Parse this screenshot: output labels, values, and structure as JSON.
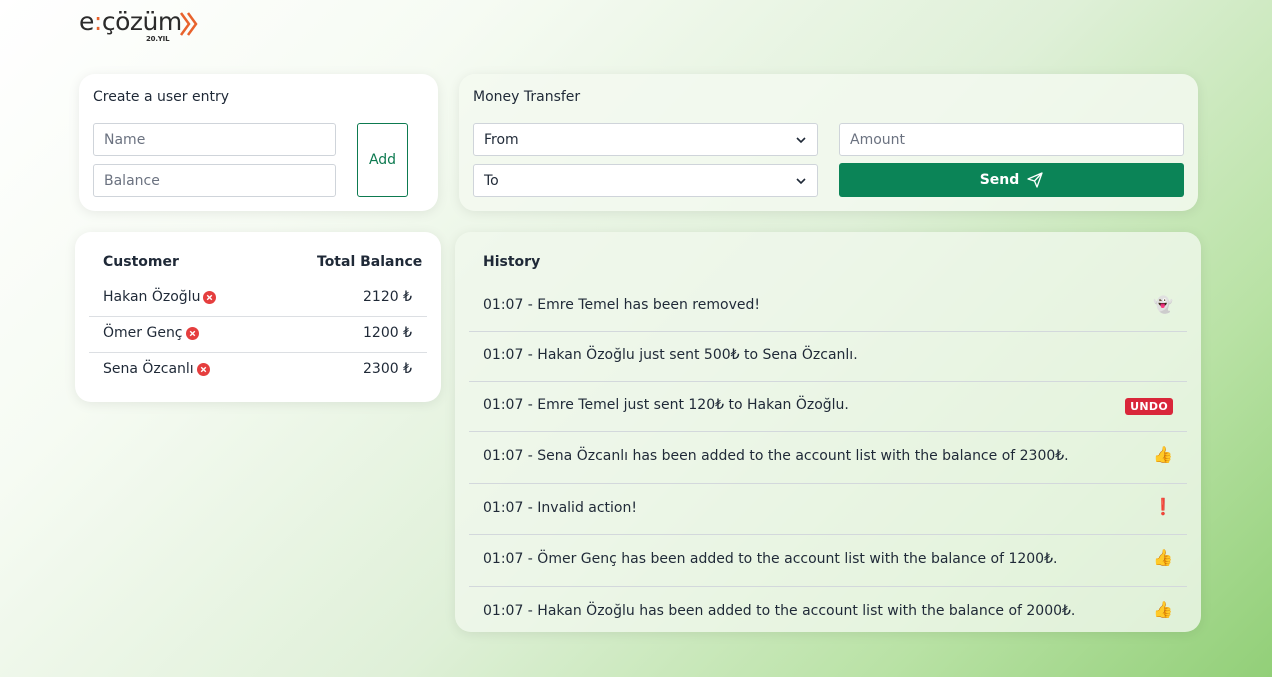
{
  "logo": {
    "brand_main": "e",
    "brand_dot": ":",
    "brand_rest": "çözüm",
    "subtitle": "20.YIL"
  },
  "create_entry": {
    "title": "Create a user entry",
    "name_placeholder": "Name",
    "balance_placeholder": "Balance",
    "add_label": "Add"
  },
  "transfer": {
    "title": "Money Transfer",
    "from_label": "From",
    "to_label": "To",
    "amount_placeholder": "Amount",
    "send_label": "Send"
  },
  "customers": {
    "header_customer": "Customer",
    "header_balance": "Total Balance",
    "rows": [
      {
        "name": "Hakan Özoğlu",
        "balance": "2120 ₺"
      },
      {
        "name": "Ömer Genç",
        "balance": "1200 ₺"
      },
      {
        "name": "Sena Özcanlı",
        "balance": "2300 ₺"
      }
    ]
  },
  "history": {
    "title": "History",
    "entries": [
      {
        "text": "01:07 - Emre Temel has been removed!",
        "icon": "ghost-icon",
        "glyph": "👻"
      },
      {
        "text": "01:07 - Hakan Özoğlu just sent 500₺ to Sena Özcanlı.",
        "icon": "",
        "glyph": ""
      },
      {
        "text": "01:07 - Emre Temel just sent 120₺ to Hakan Özoğlu.",
        "icon": "undo-button",
        "badge": "UNDO"
      },
      {
        "text": "01:07 - Sena Özcanlı has been added to the account list with the balance of 2300₺.",
        "icon": "thumbs-up-icon",
        "glyph": "👍"
      },
      {
        "text": "01:07 - Invalid action!",
        "icon": "exclamation-icon",
        "glyph": "❗"
      },
      {
        "text": "01:07 - Ömer Genç has been added to the account list with the balance of 1200₺.",
        "icon": "thumbs-up-icon",
        "glyph": "👍"
      },
      {
        "text": "01:07 - Hakan Özoğlu has been added to the account list with the balance of 2000₺.",
        "icon": "thumbs-up-icon",
        "glyph": "👍"
      }
    ]
  },
  "colors": {
    "primary_green": "#0b8457",
    "accent_orange": "#e8622c",
    "danger_red": "#d9263a"
  }
}
